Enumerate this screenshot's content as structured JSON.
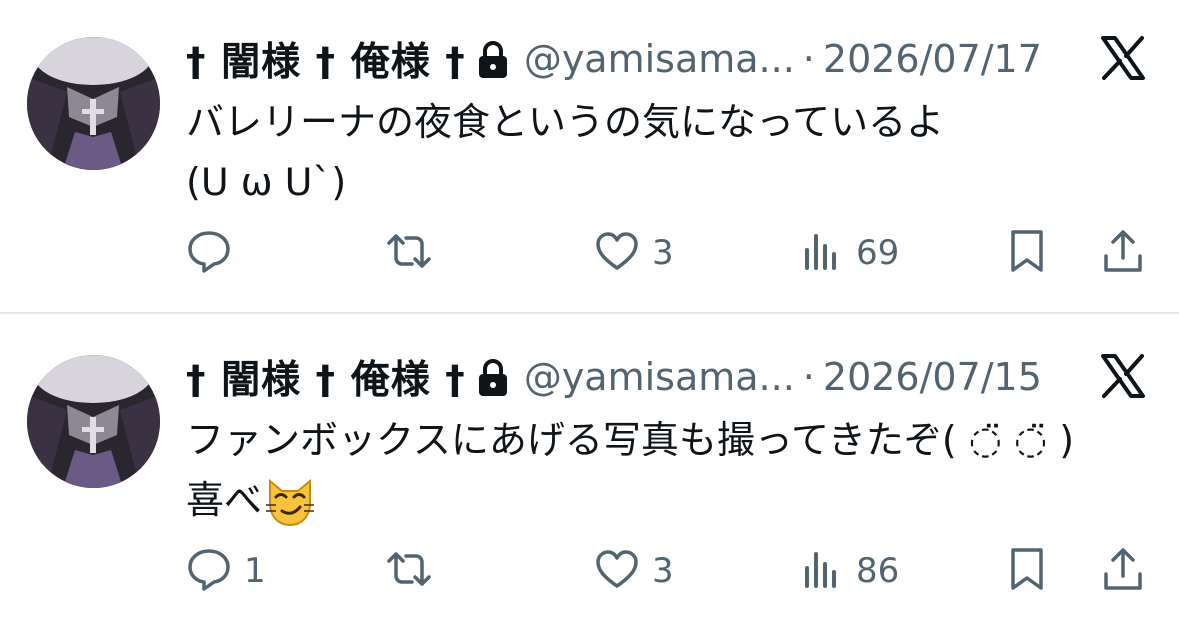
{
  "tweets": [
    {
      "display_name": "† 闇様 † 俺様 †",
      "handle": "@yamisama...",
      "separator": "·",
      "date": "2026/07/17",
      "text_lines": [
        "バレリーナの夜食というの気になっているよ",
        "(ᑌ ω ᑌ`)"
      ],
      "stats": {
        "replies": "",
        "retweets": "",
        "likes": "3",
        "views": "69"
      }
    },
    {
      "display_name": "† 闇様 † 俺様 †",
      "handle": "@yamisama...",
      "separator": "·",
      "date": "2026/07/15",
      "text_lines": [
        "ファンボックスにあげる写真も撮ってきたぞ( ◌̈ ◌̈ )",
        "喜べ"
      ],
      "stats": {
        "replies": "1",
        "retweets": "",
        "likes": "3",
        "views": "86"
      }
    }
  ],
  "icons": {
    "lock": "lock-icon",
    "platform": "x-logo-icon",
    "reply": "reply-icon",
    "retweet": "retweet-icon",
    "like": "heart-icon",
    "views": "views-chart-icon",
    "bookmark": "bookmark-icon",
    "share": "share-icon",
    "emoji": "smirking-cat-emoji"
  },
  "colors": {
    "text_primary": "#0f1419",
    "text_secondary": "#536471",
    "divider": "#e6e9ec"
  }
}
